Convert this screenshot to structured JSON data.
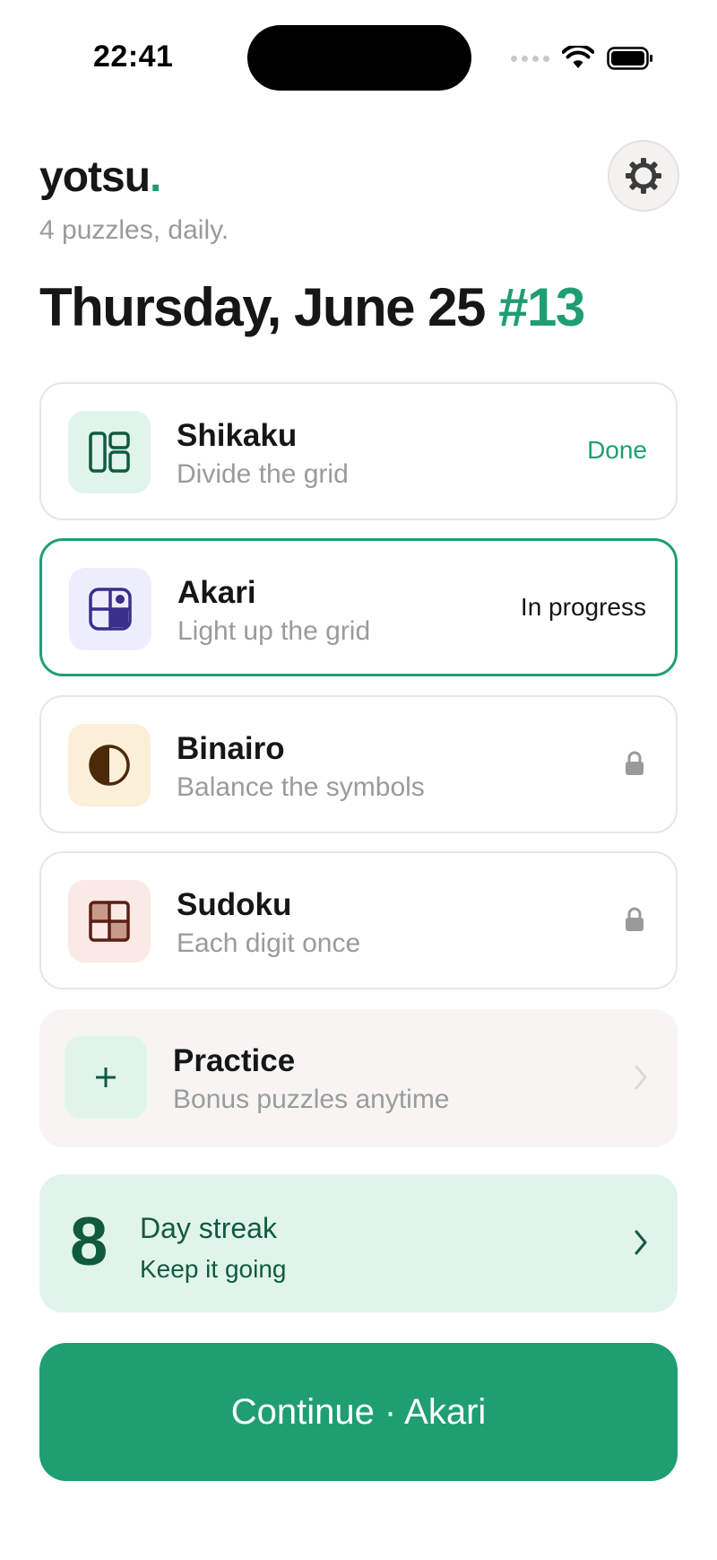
{
  "status_bar": {
    "time": "22:41"
  },
  "header": {
    "brand": "yotsu",
    "brand_dot": ".",
    "tagline": "4 puzzles, daily.",
    "date": "Thursday, June 25",
    "puzzle_number": "#13"
  },
  "puzzles": [
    {
      "title": "Shikaku",
      "subtitle": "Divide the grid",
      "status": "Done",
      "icon": "shikaku-icon"
    },
    {
      "title": "Akari",
      "subtitle": "Light up the grid",
      "status": "In progress",
      "icon": "akari-icon"
    },
    {
      "title": "Binairo",
      "subtitle": "Balance the symbols",
      "status": "locked",
      "icon": "binairo-icon"
    },
    {
      "title": "Sudoku",
      "subtitle": "Each digit once",
      "status": "locked",
      "icon": "sudoku-icon"
    }
  ],
  "practice": {
    "title": "Practice",
    "subtitle": "Bonus puzzles anytime",
    "icon": "plus-icon"
  },
  "streak": {
    "count": "8",
    "title": "Day streak",
    "subtitle": "Keep it going"
  },
  "continue_button": {
    "label": "Continue · Akari"
  },
  "colors": {
    "accent": "#1f9e72",
    "streak_bg": "#e1f4ec",
    "streak_text": "#105a40"
  }
}
